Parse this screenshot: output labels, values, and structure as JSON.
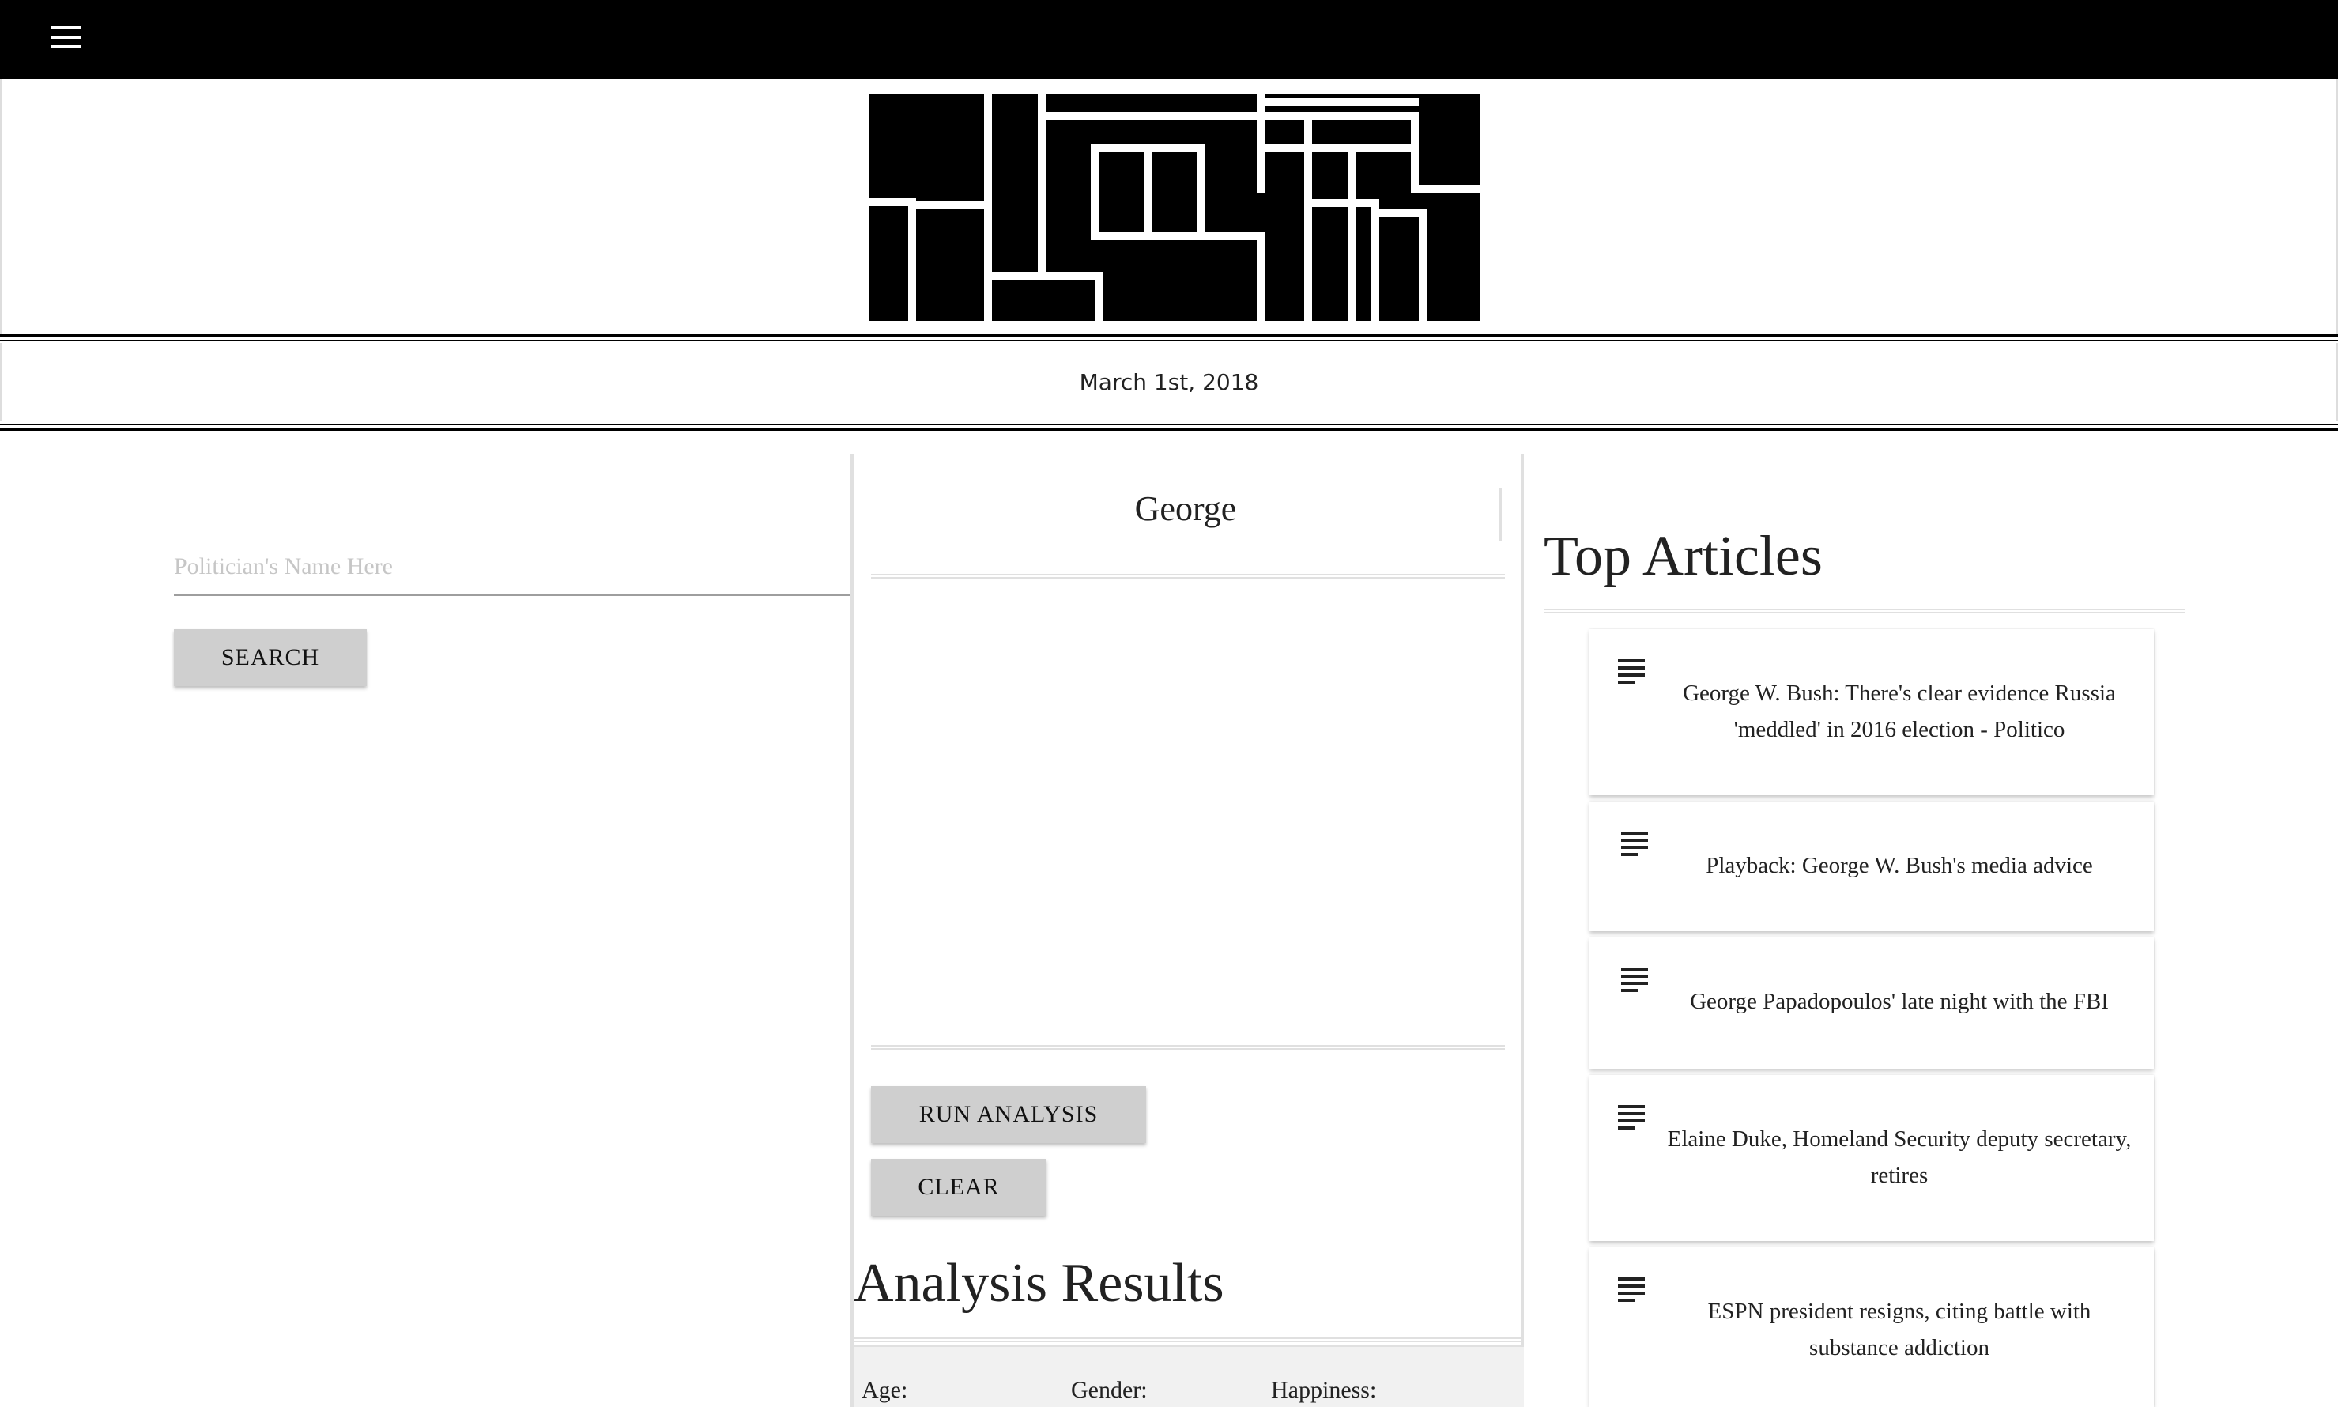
{
  "topbar": {
    "menu_icon": "hamburger-menu-icon"
  },
  "logo": {
    "name": "site-logo"
  },
  "date": "March 1st, 2018",
  "search": {
    "placeholder": "Politician's Name Here",
    "button_label": "SEARCH"
  },
  "analysis": {
    "candidate_name": "George",
    "run_label": "RUN ANALYSIS",
    "clear_label": "CLEAR",
    "results_title": "Analysis Results",
    "stats": {
      "age_label": "Age:",
      "gender_label": "Gender:",
      "happiness_label": "Happiness:"
    }
  },
  "articles": {
    "title": "Top Articles",
    "card_icon": "article-lines-icon",
    "items": [
      {
        "title": "George W. Bush: There's clear evidence Russia 'meddled' in 2016 election - Politico"
      },
      {
        "title": "Playback: George W. Bush's media advice"
      },
      {
        "title": "George Papadopoulos' late night with the FBI"
      },
      {
        "title": "Elaine Duke, Homeland Security deputy secretary, retires"
      },
      {
        "title": "ESPN president resigns, citing battle with substance addiction"
      }
    ]
  }
}
